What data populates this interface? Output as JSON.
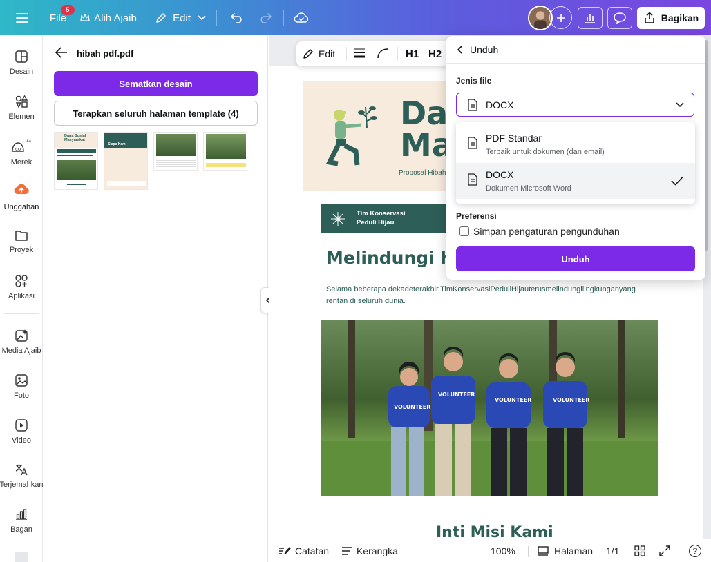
{
  "topbar": {
    "file_label": "File",
    "notification_count": "5",
    "magic_label": "Alih Ajaib",
    "edit_label": "Edit",
    "share_label": "Bagikan"
  },
  "rail": {
    "items": [
      {
        "label": "Desain",
        "icon": "layout-icon"
      },
      {
        "label": "Elemen",
        "icon": "shapes-icon"
      },
      {
        "label": "Merek",
        "icon": "brand-icon"
      },
      {
        "label": "Unggahan",
        "icon": "upload-cloud-icon"
      },
      {
        "label": "Proyek",
        "icon": "folder-icon"
      },
      {
        "label": "Aplikasi",
        "icon": "apps-icon"
      },
      {
        "label": "Media Ajaib",
        "icon": "magic-media-icon"
      },
      {
        "label": "Foto",
        "icon": "photo-icon"
      },
      {
        "label": "Video",
        "icon": "video-icon"
      },
      {
        "label": "Terjemahkan",
        "icon": "translate-icon"
      },
      {
        "label": "Bagan",
        "icon": "chart-icon"
      }
    ]
  },
  "panel": {
    "title": "hibah pdf.pdf",
    "embed_button": "Sematkan desain",
    "apply_button": "Terapkan seluruh halaman template (4)",
    "thumb1_title": "Dana Sosial Masyarakat",
    "thumb2_title": "Siapa Kami"
  },
  "toolbar": {
    "edit_label": "Edit",
    "h1": "H1",
    "h2": "H2"
  },
  "doc": {
    "title_line1": "Dana",
    "title_line2": "Ma",
    "subtitle": "Proposal Hibah",
    "team_line1": "Tim Konservasi",
    "team_line2": "Peduli Hijau",
    "heading": "Melindungi har",
    "body_line1": "Selama beberapa dekadeterakhir,TimKonservasiPeduliHijauterusmelindungilingkunganyang",
    "body_line2": "rentan di seluruh dunia.",
    "section2": "Inti Misi Kami",
    "shirt_text": "VOLUNTEER"
  },
  "popover": {
    "back_label": "Unduh",
    "filetype_label": "Jenis file",
    "selected_type": "DOCX",
    "options": [
      {
        "title": "PDF Standar",
        "desc": "Terbaik untuk dokumen (dan email)"
      },
      {
        "title": "DOCX",
        "desc": "Dokumen Microsoft Word"
      }
    ],
    "pref_label": "Preferensi",
    "save_settings_label": "Simpan pengaturan pengunduhan",
    "download_button": "Unduh"
  },
  "bottombar": {
    "notes": "Catatan",
    "outline": "Kerangka",
    "zoom": "100%",
    "pages_label": "Halaman",
    "page_count": "1/1",
    "help": "?"
  },
  "colors": {
    "accent": "#7d2ae8",
    "doc_green": "#2d5e57",
    "doc_cream": "#f7ebdd"
  }
}
